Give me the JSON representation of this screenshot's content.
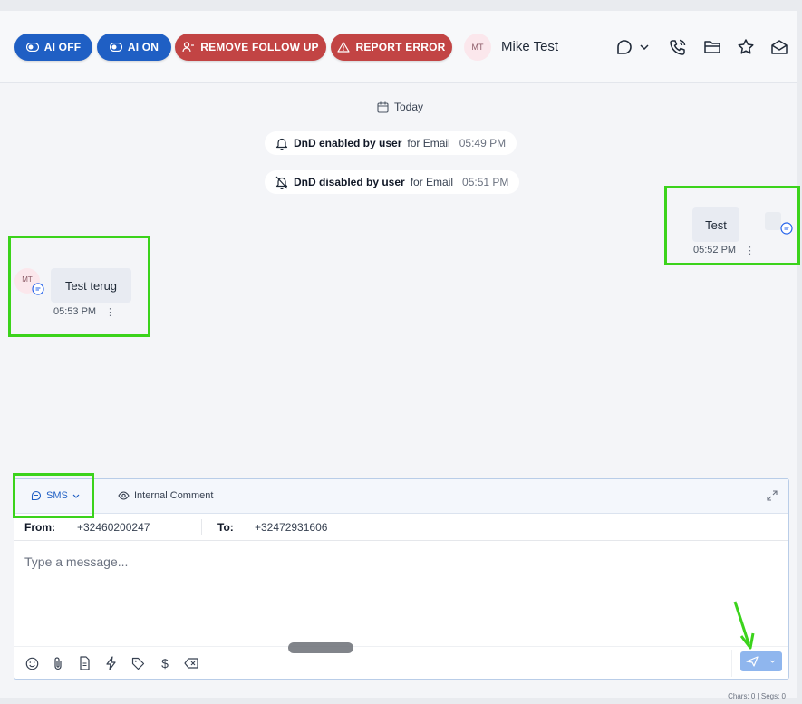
{
  "header": {
    "buttons": {
      "ai_off": "AI OFF",
      "ai_on": "AI ON",
      "remove_follow_up": "REMOVE FOLLOW UP",
      "report_error": "REPORT ERROR"
    },
    "contact": {
      "initials": "MT",
      "name": "Mike Test"
    },
    "icons": [
      "chat-bubble-icon",
      "chevron-down-icon",
      "phone-icon",
      "folder-icon",
      "star-icon",
      "mail-icon"
    ]
  },
  "conversation": {
    "date_chip": "Today",
    "events": [
      {
        "bold": "DnD enabled by user",
        "rest": "for Email",
        "time": "05:49 PM",
        "icon": "bell-icon"
      },
      {
        "bold": "DnD disabled by user",
        "rest": "for Email",
        "time": "05:51 PM",
        "icon": "bell-off-icon"
      }
    ],
    "messages": [
      {
        "direction": "outbound",
        "text": "Test",
        "time": "05:52 PM"
      },
      {
        "direction": "inbound",
        "initials": "MT",
        "text": "Test terug",
        "time": "05:53 PM"
      }
    ]
  },
  "composer": {
    "channel": "SMS",
    "internal_comment": "Internal Comment",
    "from_label": "From:",
    "from_value": "+32460200247",
    "to_label": "To:",
    "to_value": "+32472931606",
    "placeholder": "Type a message...",
    "counts": "Chars: 0 | Segs: 0"
  },
  "colors": {
    "accent_blue": "#1f5fc4",
    "danger_red": "#c24444",
    "highlight_green": "#3bd31b",
    "send_button": "#8fb6ee"
  }
}
